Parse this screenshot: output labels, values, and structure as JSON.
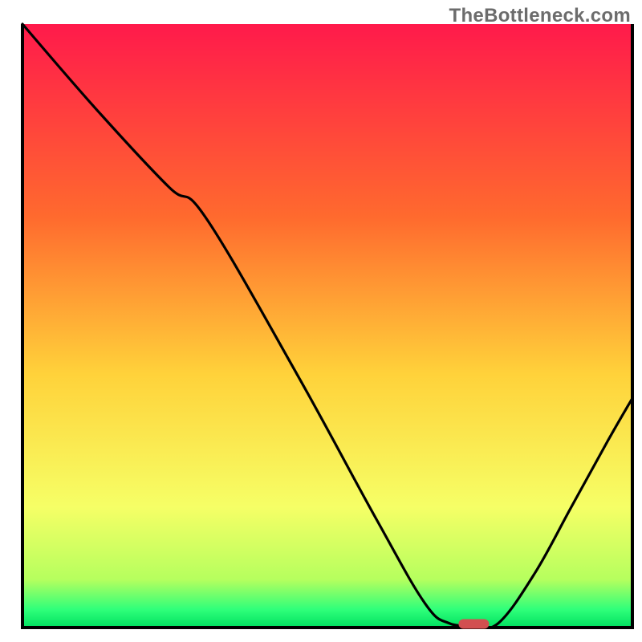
{
  "watermark": "TheBottleneck.com",
  "colors": {
    "frame": "#000000",
    "curve": "#000000",
    "marker_fill": "#d24f50",
    "gradient_top": "#ff1a4b",
    "gradient_mid1": "#ff6a2e",
    "gradient_mid2": "#ffd23a",
    "gradient_low": "#f6ff66",
    "gradient_green1": "#b6ff5e",
    "gradient_green2": "#2fff7a",
    "gradient_bottom": "#00e060"
  },
  "chart_data": {
    "type": "line",
    "title": "",
    "xlabel": "",
    "ylabel": "",
    "xlim": [
      0,
      100
    ],
    "ylim": [
      0,
      100
    ],
    "grid": false,
    "legend": false,
    "series": [
      {
        "name": "bottleneck-curve",
        "x": [
          0,
          12,
          24,
          30,
          45,
          58,
          66,
          70,
          74,
          78,
          84,
          90,
          96,
          100
        ],
        "y": [
          100,
          86,
          73,
          68,
          42,
          18,
          4,
          0.7,
          0.5,
          0.7,
          9,
          20,
          31,
          38
        ]
      }
    ],
    "marker": {
      "x": 74,
      "y": 0.6,
      "w": 5,
      "h": 1.6,
      "rx": 1.2
    },
    "annotations": []
  }
}
